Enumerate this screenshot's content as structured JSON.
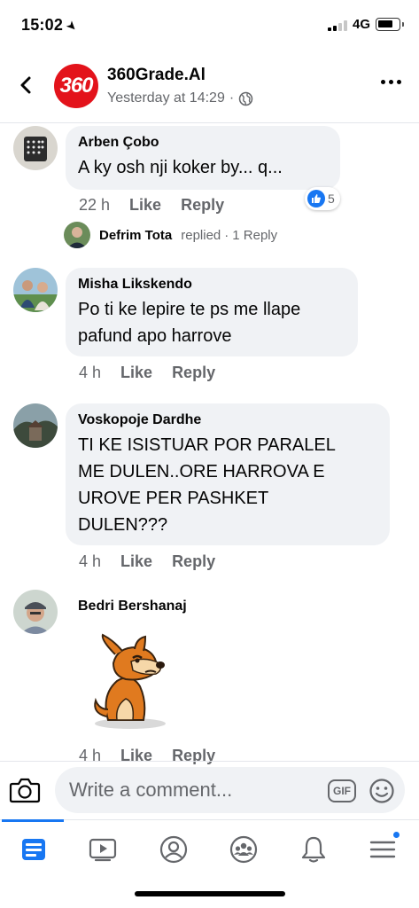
{
  "status_bar": {
    "time": "15:02",
    "network": "4G"
  },
  "post_header": {
    "page_name": "360Grade.Al",
    "logo_text": "360",
    "timestamp": "Yesterday at 14:29",
    "separator": "·"
  },
  "comments": [
    {
      "author": "Arben Çobo",
      "text": "A ky osh nji koker by... q...",
      "time": "22 h",
      "like_label": "Like",
      "reply_label": "Reply",
      "reaction_count": "5",
      "reply_summary": {
        "name": "Defrim Tota",
        "action": "replied",
        "separator": "·",
        "count_text": "1 Reply"
      }
    },
    {
      "author": "Misha Likskendo",
      "text_lines": [
        "Po ti ke lepire te ps me llape",
        "pafund apo harrove"
      ],
      "time": "4 h",
      "like_label": "Like",
      "reply_label": "Reply"
    },
    {
      "author": "Voskopoje Dardhe",
      "text_lines": [
        "TI KE ISISTUAR POR PARALEL",
        "ME DULEN..ORE HARROVA E",
        "UROVE PER PASHKET",
        "DULEN???"
      ],
      "time": "4 h",
      "like_label": "Like",
      "reply_label": "Reply"
    },
    {
      "author": "Bedri Bershanaj",
      "sticker": "sad-dog-sticker",
      "time": "4 h",
      "like_label": "Like",
      "reply_label": "Reply"
    }
  ],
  "composer": {
    "placeholder": "Write a comment...",
    "gif_label": "GIF"
  },
  "tab_bar": {
    "items": [
      "home-feed-icon",
      "watch-icon",
      "profile-icon",
      "groups-icon",
      "notifications-icon",
      "menu-icon"
    ],
    "active_color": "#1877f2",
    "inactive_color": "#65676b"
  },
  "colors": {
    "brand": "#e3131b",
    "accent": "#1877f2",
    "bubble": "#f0f2f5",
    "meta": "#65676b"
  }
}
